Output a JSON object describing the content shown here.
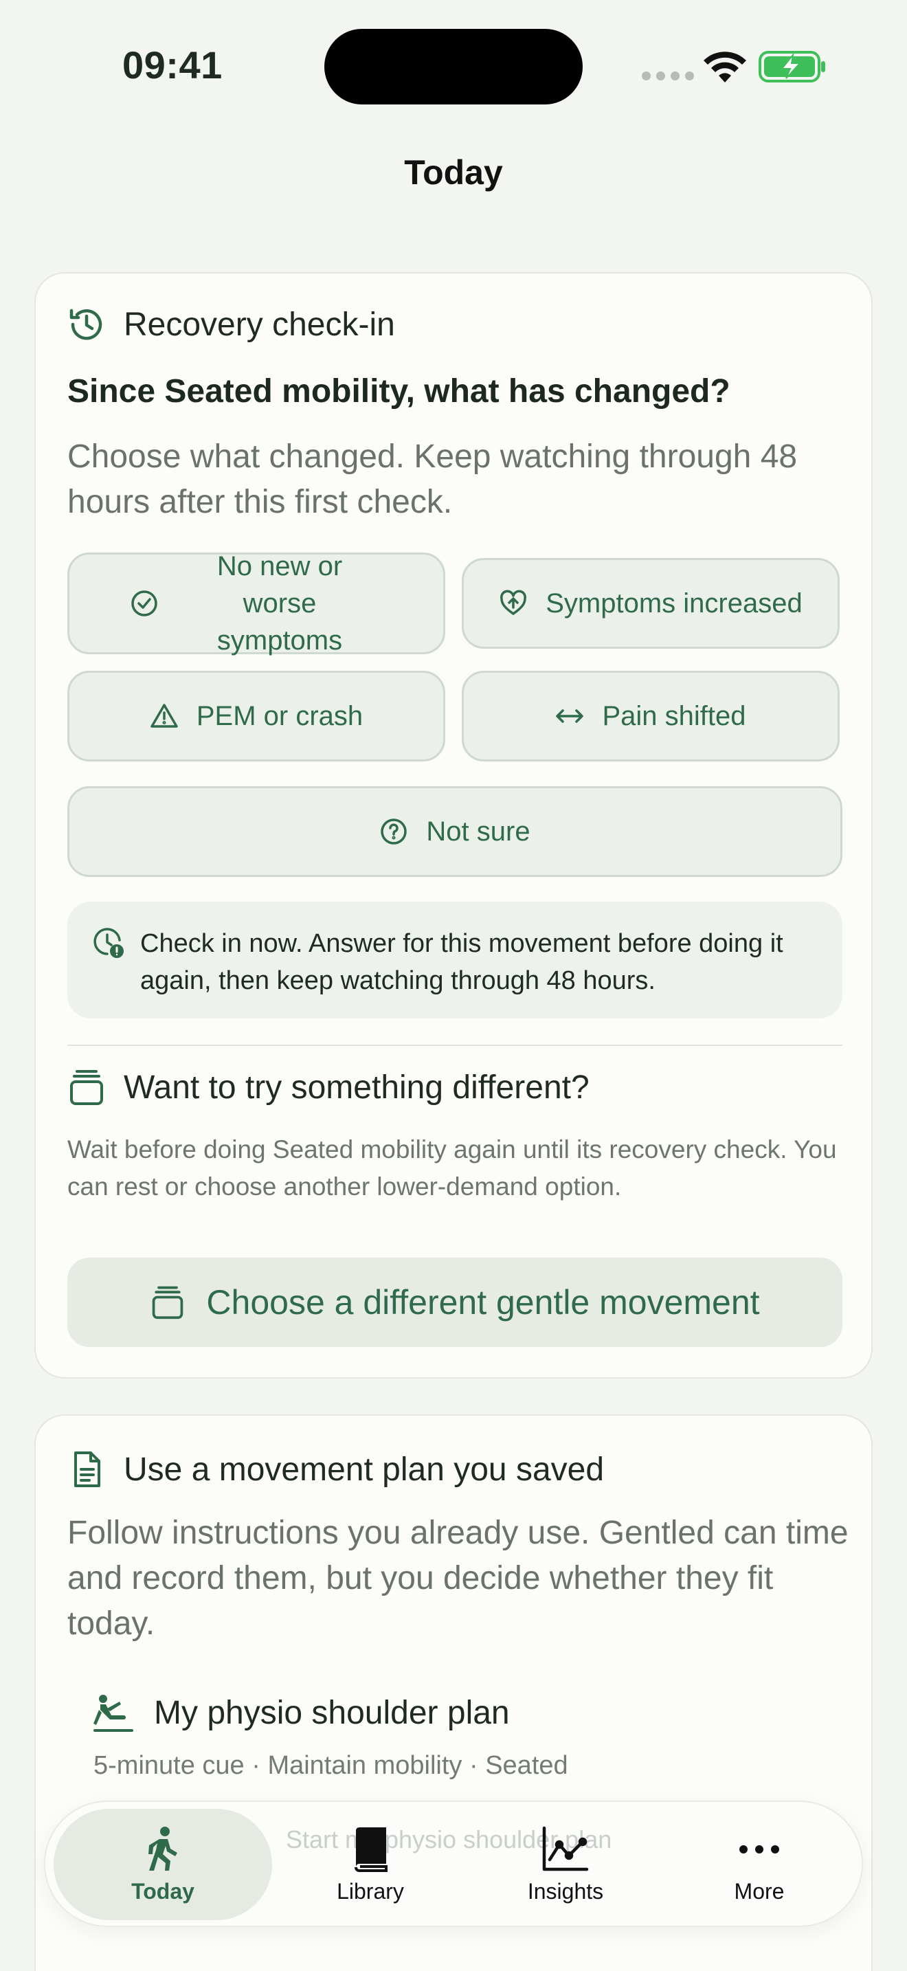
{
  "status": {
    "time": "09:41"
  },
  "nav": {
    "title": "Today"
  },
  "checkin": {
    "header": "Recovery check-in",
    "question": "Since Seated mobility, what has changed?",
    "subtitle": "Choose what changed. Keep watching through 48 hours after this first check.",
    "options": {
      "no_new": "No new or worse symptoms",
      "increased": "Symptoms increased",
      "pem": "PEM or crash",
      "pain": "Pain shifted",
      "not_sure": "Not sure"
    },
    "info": "Check in now. Answer for this movement before doing it again, then keep watching through 48 hours."
  },
  "alternative": {
    "header": "Want to try something different?",
    "description": "Wait before doing Seated mobility again until its recovery check. You can rest or choose another lower-demand option.",
    "button": "Choose a different gentle movement"
  },
  "saved_plan": {
    "header": "Use a movement plan you saved",
    "description": "Follow instructions you already use. Gentled can time and record them, but you decide whether they fit today.",
    "plan_title": "My physio shoulder plan",
    "plan_meta": "5-minute cue · Maintain mobility · Seated",
    "behind_1": "Start my physio shoulder plan"
  },
  "tabs": {
    "today": "Today",
    "library": "Library",
    "insights": "Insights",
    "more": "More"
  },
  "colors": {
    "accent": "#2f6b4b",
    "background": "#f3f5f0",
    "card": "#fcfdf8"
  }
}
